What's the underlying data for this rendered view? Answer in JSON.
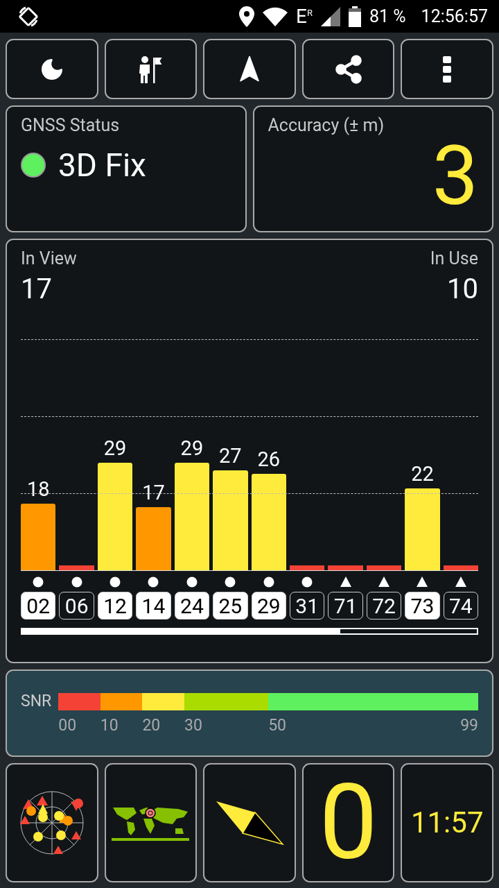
{
  "status_bar": {
    "network": "E",
    "roaming": "R",
    "battery": "81 %",
    "time": "12:56:57"
  },
  "toolbar": [
    {
      "kind": "night-mode"
    },
    {
      "kind": "waypoint"
    },
    {
      "kind": "navigate"
    },
    {
      "kind": "share"
    },
    {
      "kind": "more"
    }
  ],
  "gnss_status": {
    "title": "GNSS Status",
    "value": "3D Fix",
    "color": "#5ef05e"
  },
  "accuracy": {
    "title": "Accuracy (± m)",
    "value": "3"
  },
  "satellites": {
    "in_view_label": "In View",
    "in_view": "17",
    "in_use_label": "In Use",
    "in_use": "10",
    "items": [
      {
        "id": "02",
        "snr": "18",
        "color": "#ff9800",
        "in_use": true,
        "kind": "circle"
      },
      {
        "id": "06",
        "color": "#f44336",
        "in_use": false,
        "kind": "circle"
      },
      {
        "id": "12",
        "snr": "29",
        "color": "#ffeb3b",
        "in_use": true,
        "kind": "circle"
      },
      {
        "id": "14",
        "snr": "17",
        "color": "#ff9800",
        "in_use": true,
        "kind": "circle"
      },
      {
        "id": "24",
        "snr": "29",
        "color": "#ffeb3b",
        "in_use": true,
        "kind": "circle"
      },
      {
        "id": "25",
        "snr": "27",
        "color": "#ffeb3b",
        "in_use": true,
        "kind": "circle"
      },
      {
        "id": "29",
        "snr": "26",
        "color": "#ffeb3b",
        "in_use": true,
        "kind": "circle"
      },
      {
        "id": "31",
        "color": "#f44336",
        "in_use": false,
        "kind": "circle"
      },
      {
        "id": "71",
        "color": "#f44336",
        "in_use": false,
        "kind": "triangle"
      },
      {
        "id": "72",
        "color": "#f44336",
        "in_use": false,
        "kind": "triangle"
      },
      {
        "id": "73",
        "snr": "22",
        "color": "#ffeb3b",
        "in_use": true,
        "kind": "triangle"
      },
      {
        "id": "74",
        "color": "#f44336",
        "in_use": false,
        "kind": "triangle"
      }
    ]
  },
  "snr_legend": {
    "label": "SNR",
    "ticks": [
      "00",
      "10",
      "20",
      "30",
      "50",
      "99"
    ]
  },
  "tiles": {
    "speed": "0",
    "clock": "11:57"
  }
}
